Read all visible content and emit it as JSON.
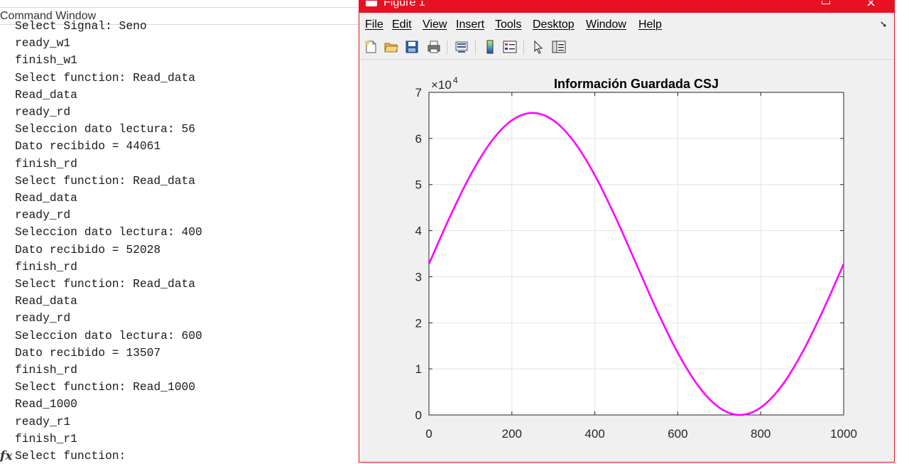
{
  "command_window": {
    "title": "Command Window",
    "lines": [
      "Select Signal: Seno",
      "ready_w1",
      "finish_w1",
      "Select function: Read_data",
      "Read_data",
      "ready_rd",
      "Seleccion dato lectura: 56",
      "Dato recibido = 44061",
      "finish_rd",
      "Select function: Read_data",
      "Read_data",
      "ready_rd",
      "Seleccion dato lectura: 400",
      "Dato recibido = 52028",
      "finish_rd",
      "Select function: Read_data",
      "Read_data",
      "ready_rd",
      "Seleccion dato lectura: 600",
      "Dato recibido = 13507",
      "finish_rd",
      "Select function: Read_1000",
      "Read_1000",
      "ready_r1",
      "finish_r1",
      "Select function:"
    ],
    "prompt_icon": "fx-icon"
  },
  "figure_window": {
    "title": "Figure 1",
    "titlebar_color": "#e81123",
    "menu": [
      "File",
      "Edit",
      "View",
      "Insert",
      "Tools",
      "Desktop",
      "Window",
      "Help"
    ],
    "toolbar_icons": [
      "new-figure-icon",
      "open-file-icon",
      "save-icon",
      "print-icon",
      "link-figure-icon",
      "colorbar-icon",
      "legend-icon",
      "select-arrow-icon",
      "property-inspector-icon"
    ]
  },
  "chart_data": {
    "type": "line",
    "title": "Información Guardada CSJ",
    "xlabel": "",
    "ylabel": "",
    "xlim": [
      0,
      1000
    ],
    "ylim": [
      0,
      70000
    ],
    "y_exponent_label": "×10",
    "y_exponent_power": "4",
    "xticks": [
      0,
      200,
      400,
      600,
      800,
      1000
    ],
    "yticks": [
      0,
      1,
      2,
      3,
      4,
      5,
      6,
      7
    ],
    "grid": true,
    "series": [
      {
        "color": "#ff00ff",
        "x": [
          0,
          50,
          100,
          150,
          200,
          250,
          300,
          350,
          400,
          450,
          500,
          550,
          600,
          650,
          700,
          750,
          800,
          850,
          900,
          950,
          1000
        ],
        "y": [
          32767,
          42892,
          52027,
          59280,
          63930,
          65534,
          63930,
          59280,
          52027,
          42892,
          32767,
          22642,
          13507,
          6254,
          1604,
          0,
          1604,
          6254,
          13507,
          22642,
          32767
        ]
      }
    ]
  }
}
